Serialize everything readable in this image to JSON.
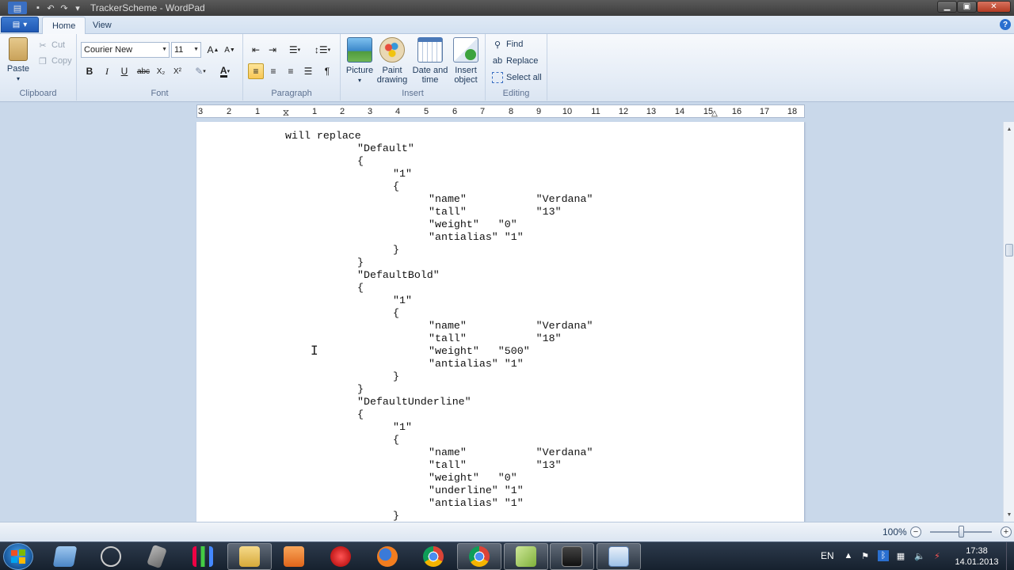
{
  "window": {
    "title": "TrackerScheme - WordPad",
    "quick_access": [
      "save-icon",
      "undo-icon",
      "redo-icon",
      "customize-icon"
    ]
  },
  "tabs": [
    {
      "label": "Home",
      "active": true
    },
    {
      "label": "View",
      "active": false
    }
  ],
  "ribbon": {
    "clipboard": {
      "group_label": "Clipboard",
      "paste": "Paste",
      "cut": "Cut",
      "copy": "Copy"
    },
    "font": {
      "group_label": "Font",
      "family": "Courier New",
      "size": "11",
      "bold": "B",
      "italic": "I",
      "underline": "U",
      "strike": "abc",
      "subscript": "X₂",
      "superscript": "X²"
    },
    "paragraph": {
      "group_label": "Paragraph"
    },
    "insert": {
      "group_label": "Insert",
      "picture": "Picture",
      "paint_line1": "Paint",
      "paint_line2": "drawing",
      "date_line1": "Date and",
      "date_line2": "time",
      "object_line1": "Insert",
      "object_line2": "object"
    },
    "editing": {
      "group_label": "Editing",
      "find": "Find",
      "replace": "Replace",
      "select_all": "Select all"
    }
  },
  "ruler": {
    "ticks": [
      "3",
      "2",
      "1",
      "1",
      "2",
      "3",
      "4",
      "5",
      "6",
      "7",
      "8",
      "9",
      "10",
      "11",
      "12",
      "13",
      "14",
      "15",
      "16",
      "17",
      "18"
    ]
  },
  "document": {
    "lines": [
      "will replace",
      "\"Default\"",
      "{",
      "\"1\"",
      "{",
      "\"name\"           \"Verdana\"",
      "\"tall\"           \"13\"",
      "\"weight\"   \"0\"",
      "\"antialias\" \"1\"",
      "}",
      "}",
      "\"DefaultBold\"",
      "{",
      "\"1\"",
      "{",
      "\"name\"           \"Verdana\"",
      "\"tall\"           \"18\"",
      "\"weight\"   \"500\"",
      "\"antialias\" \"1\"",
      "}",
      "}",
      "\"DefaultUnderline\"",
      "{",
      "\"1\"",
      "{",
      "\"name\"           \"Verdana\"",
      "\"tall\"           \"13\"",
      "\"weight\"   \"0\"",
      "\"underline\" \"1\"",
      "\"antialias\" \"1\"",
      "}"
    ]
  },
  "status": {
    "zoom": "100%",
    "zoom_fraction": 0.5
  },
  "taskbar": {
    "apps": [
      "wordpad-icon",
      "cue-icon",
      "tool-icon",
      "stats-icon",
      "explorer-icon",
      "media-icon",
      "red-app-icon",
      "firefox-icon",
      "chrome-icon",
      "chrome-icon",
      "green-app-icon",
      "game-icon",
      "wordpad-icon"
    ],
    "language": "EN",
    "time": "17:38",
    "date": "14.01.2013"
  }
}
